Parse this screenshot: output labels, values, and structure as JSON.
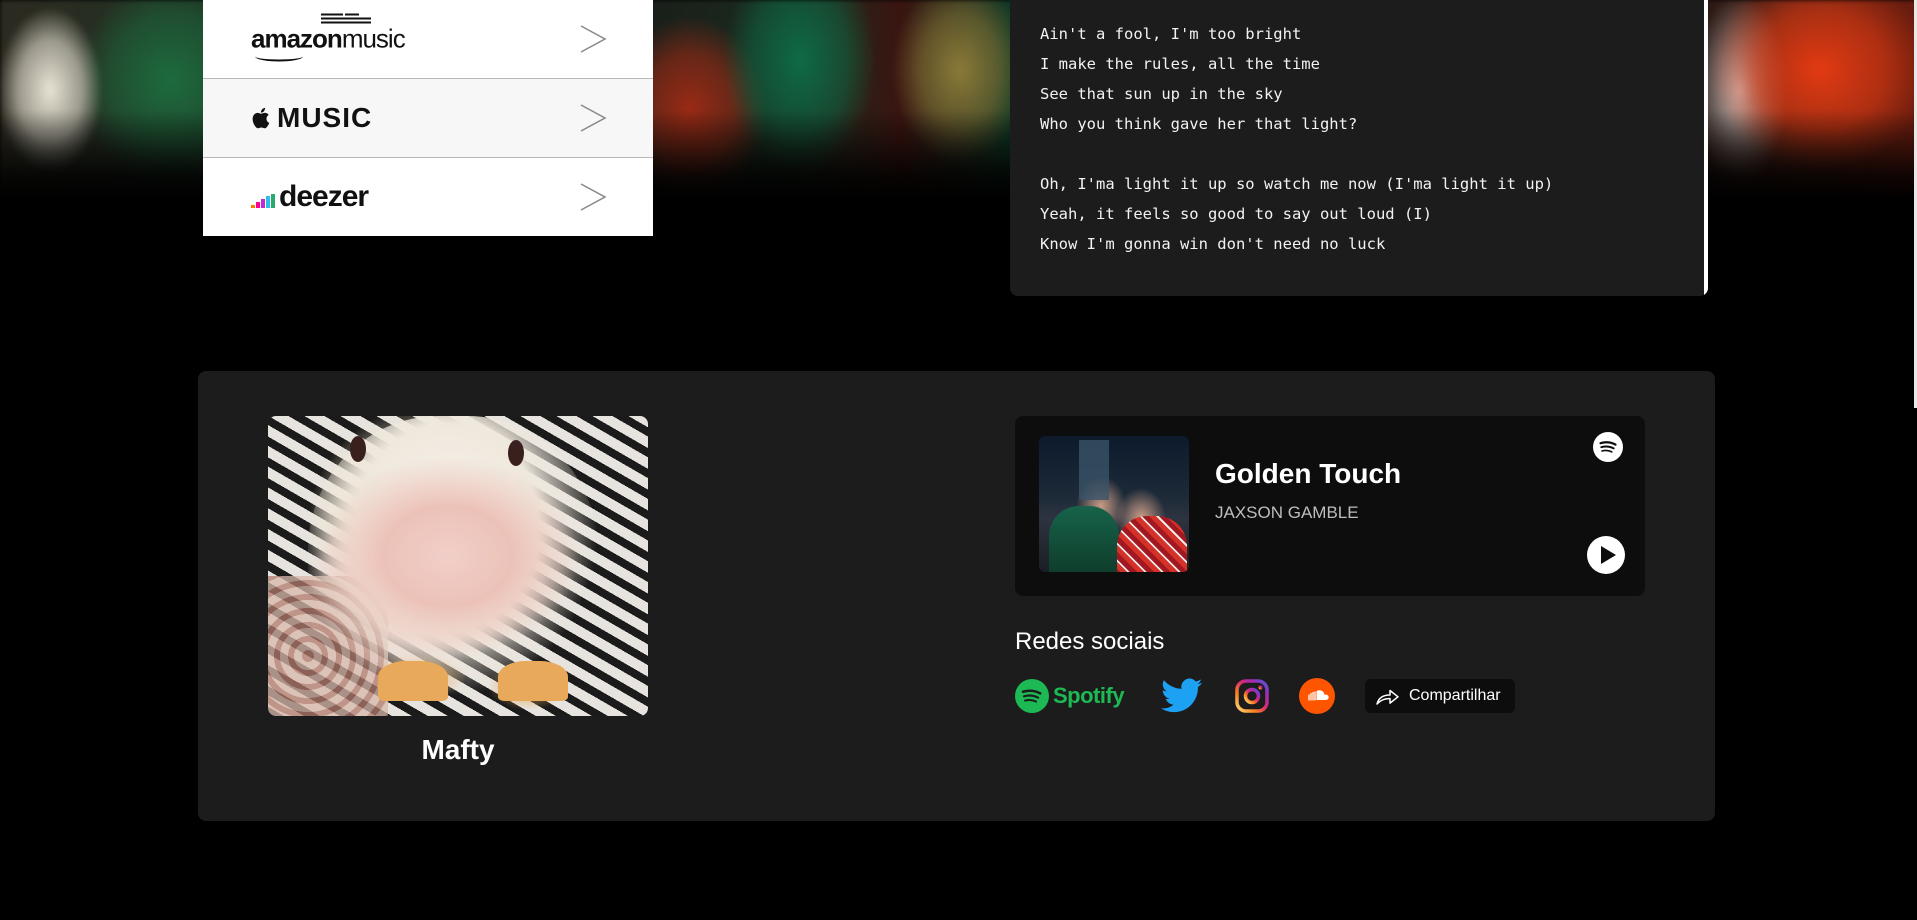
{
  "services": [
    {
      "name": "amazon music",
      "logo_text_bold": "amazon",
      "logo_text_light": "music",
      "icon": "amazon-music-logo",
      "arrow_icon": "chevron-right-icon"
    },
    {
      "name": "Apple Music",
      "logo_text": "MUSIC",
      "icon": "apple-icon",
      "arrow_icon": "chevron-right-icon"
    },
    {
      "name": "deezer",
      "logo_text": "deezer",
      "icon": "deezer-logo",
      "arrow_icon": "chevron-right-icon"
    }
  ],
  "lyrics": {
    "lines": [
      "Ain't a fool, I'm too bright",
      "I make the rules, all the time",
      "See that sun up in the sky",
      "Who you think gave her that light?",
      "",
      "Oh, I'ma light it up so watch me now (I'ma light it up)",
      "Yeah, it feels so good to say out loud (I)",
      "Know I'm gonna win don't need no luck"
    ]
  },
  "artist": {
    "name": "Mafty",
    "photo_icon": "artist-photo"
  },
  "player": {
    "song_title": "Golden Touch",
    "song_artist": "JAXSON GAMBLE",
    "provider_icon": "spotify-icon",
    "play_icon": "play-icon"
  },
  "social": {
    "heading": "Redes sociais",
    "spotify_label": "Spotify",
    "share_label": "Compartilhar",
    "icons": [
      "spotify-icon",
      "twitter-icon",
      "instagram-icon",
      "soundcloud-icon",
      "share-icon"
    ]
  },
  "colors": {
    "page_bg": "#000000",
    "card_bg": "#1c1c1c",
    "player_bg": "#0d0d0d",
    "spotify_green": "#1db954",
    "twitter_blue": "#1da1f2",
    "soundcloud_orange": "#ff5500"
  }
}
